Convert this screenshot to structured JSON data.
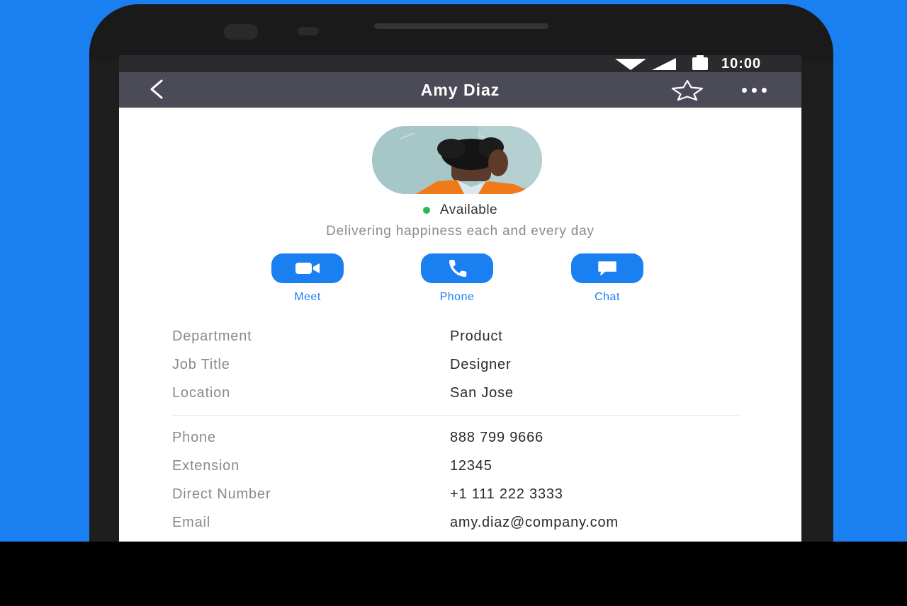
{
  "status_bar": {
    "time": "10:00"
  },
  "header": {
    "title": "Amy Diaz",
    "back_icon": "chevron-left",
    "star_icon": "star-outline",
    "more_icon": "ellipsis-horizontal"
  },
  "profile": {
    "presence": "Available",
    "presence_color": "#2eb85c",
    "status_message": "Delivering happiness each and every day"
  },
  "actions": [
    {
      "label": "Meet",
      "icon": "video-camera"
    },
    {
      "label": "Phone",
      "icon": "phone-handset"
    },
    {
      "label": "Chat",
      "icon": "chat-bubble"
    }
  ],
  "details": {
    "org": [
      {
        "label": "Department",
        "value": "Product"
      },
      {
        "label": "Job Title",
        "value": "Designer"
      },
      {
        "label": "Location",
        "value": "San Jose"
      }
    ],
    "contact": [
      {
        "label": "Phone",
        "value": "888 799 9666"
      },
      {
        "label": "Extension",
        "value": "12345"
      },
      {
        "label": "Direct Number",
        "value": "+1 111 222 3333"
      },
      {
        "label": "Email",
        "value": "amy.diaz@company.com"
      }
    ]
  },
  "colors": {
    "accent": "#1a7ff0",
    "nav_bar": "#4b4b58",
    "background": "#1a7ff0"
  }
}
